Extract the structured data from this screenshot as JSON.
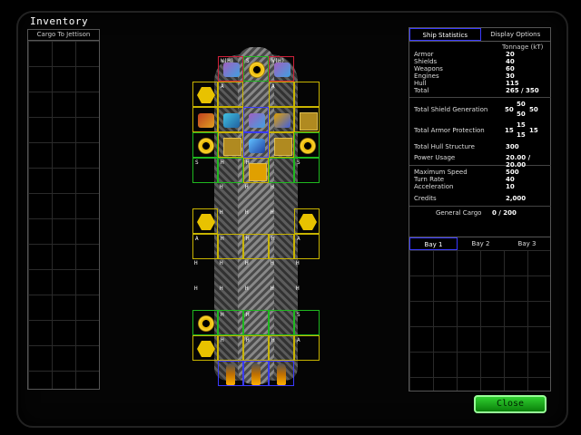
{
  "title": "Inventory",
  "jettison": {
    "header": "Cargo To Jettison"
  },
  "tabs": {
    "ship_statistics": "Ship Statistics",
    "display_options": "Display Options"
  },
  "stats": {
    "tonnage_label": "Tonnage (kT)",
    "armor": {
      "label": "Armor",
      "value": "20"
    },
    "shields": {
      "label": "Shields",
      "value": "40"
    },
    "weapons": {
      "label": "Weapons",
      "value": "60"
    },
    "engines": {
      "label": "Engines",
      "value": "30"
    },
    "hull": {
      "label": "Hull",
      "value": "115"
    },
    "total": {
      "label": "Total",
      "value": "265 / 350"
    },
    "shield_gen": {
      "label": "Total Shield Generation",
      "left": "50",
      "top": "50",
      "bottom": "50",
      "right": "50"
    },
    "armor_prot": {
      "label": "Total Armor Protection",
      "left": "15",
      "top": "15",
      "bottom": "15",
      "right": "15"
    },
    "hull_struct": {
      "label": "Total Hull Structure",
      "value": "300"
    },
    "power": {
      "label": "Power Usage",
      "value": "20.00 / 20.00"
    },
    "max_speed": {
      "label": "Maximum Speed",
      "value": "500"
    },
    "turn_rate": {
      "label": "Turn Rate",
      "value": "40"
    },
    "acceleration": {
      "label": "Acceleration",
      "value": "10"
    },
    "credits": {
      "label": "Credits",
      "value": "2,000"
    },
    "general_cargo": {
      "label": "General Cargo",
      "value": "0 / 200"
    }
  },
  "bays": {
    "bay1": "Bay 1",
    "bay2": "Bay 2",
    "bay3": "Bay 3"
  },
  "close_label": "Close",
  "ship_slots": {
    "r0": [
      "W(H)",
      "S",
      "W(H)"
    ],
    "r1": [
      "A",
      "A"
    ],
    "r4": [
      "S",
      "H",
      "H",
      "S"
    ],
    "r5": [
      "H",
      "H",
      "H"
    ],
    "r6": [
      "H",
      "H",
      "H"
    ],
    "r7": [
      "A",
      "H",
      "H",
      "H",
      "A"
    ],
    "r8": [
      "H",
      "H",
      "H",
      "H",
      "H"
    ],
    "r9": [
      "H",
      "H",
      "H",
      "H",
      "H"
    ],
    "r10": [
      "S",
      "H",
      "H",
      "S"
    ],
    "r11": [
      "A",
      "H",
      "H",
      "H",
      "A"
    ]
  }
}
